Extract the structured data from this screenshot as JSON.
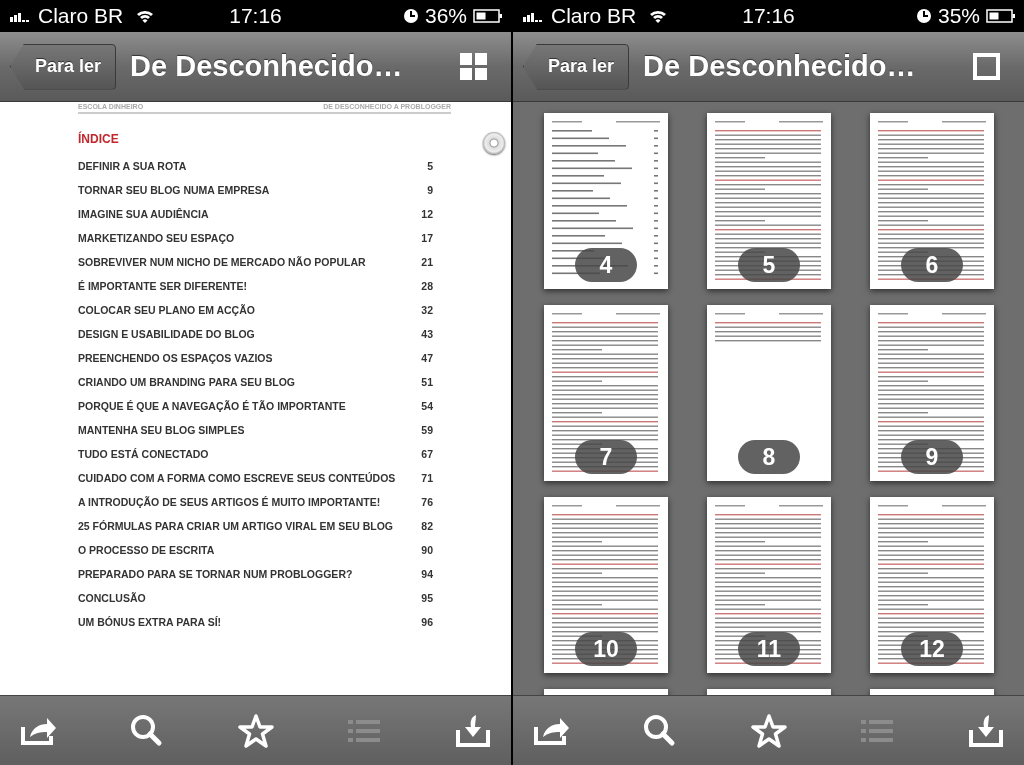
{
  "screens": [
    {
      "kind": "reader",
      "status_bar": {
        "carrier": "Claro BR",
        "time": "17:16",
        "battery": "36%"
      },
      "nav": {
        "back": "Para ler",
        "title": "De Desconhecido…",
        "view_button": {
          "kind": "grid"
        }
      },
      "page": {
        "header_left": "ESCOLA DINHEIRO",
        "header_right": "DE DESCONHECIDO A PROBLOGGER",
        "heading": "ÍNDICE",
        "entries": [
          {
            "title": "DEFINIR A SUA ROTA",
            "page": "5"
          },
          {
            "title": "TORNAR SEU BLOG NUMA EMPRESA",
            "page": "9"
          },
          {
            "title": "IMAGINE SUA AUDIÊNCIA",
            "page": "12"
          },
          {
            "title": "MARKETIZANDO SEU ESPAÇO",
            "page": "17"
          },
          {
            "title": "SOBREVIVER NUM NICHO DE MERCADO NÃO POPULAR",
            "page": "21"
          },
          {
            "title": "É IMPORTANTE SER DIFERENTE!",
            "page": "28"
          },
          {
            "title": "COLOCAR SEU PLANO EM ACÇÃO",
            "page": "32"
          },
          {
            "title": "DESIGN E USABILIDADE DO BLOG",
            "page": "43"
          },
          {
            "title": "PREENCHENDO OS ESPAÇOS VAZIOS",
            "page": "47"
          },
          {
            "title": "CRIANDO UM BRANDING PARA SEU BLOG",
            "page": "51"
          },
          {
            "title": "PORQUE É QUE A NAVEGAÇÃO É TÃO IMPORTANTE",
            "page": "54"
          },
          {
            "title": "MANTENHA SEU BLOG SIMPLES",
            "page": "59"
          },
          {
            "title": "TUDO ESTÁ CONECTADO",
            "page": "67"
          },
          {
            "title": "CUIDADO COM A FORMA COMO ESCREVE SEUS CONTEÚDOS",
            "page": "71"
          },
          {
            "title": "A INTRODUÇÃO DE SEUS ARTIGOS É MUITO IMPORTANTE!",
            "page": "76"
          },
          {
            "title": "25 FÓRMULAS PARA CRIAR UM ARTIGO VIRAL EM SEU BLOG",
            "page": "82"
          },
          {
            "title": "O PROCESSO DE ESCRITA",
            "page": "90"
          },
          {
            "title": "PREPARADO PARA SE TORNAR NUM PROBLOGGER?",
            "page": "94"
          },
          {
            "title": "CONCLUSÃO",
            "page": "95"
          },
          {
            "title": "UM BÓNUS EXTRA PARA SÍ!",
            "page": "96"
          }
        ]
      },
      "toolbar": [
        {
          "kind": "share",
          "disabled": false
        },
        {
          "kind": "search",
          "disabled": false
        },
        {
          "kind": "star",
          "disabled": false
        },
        {
          "kind": "list",
          "disabled": true
        },
        {
          "kind": "download",
          "disabled": false
        }
      ]
    },
    {
      "kind": "grid",
      "status_bar": {
        "carrier": "Claro BR",
        "time": "17:16",
        "battery": "35%"
      },
      "nav": {
        "back": "Para ler",
        "title": "De Desconhecido…",
        "view_button": {
          "kind": "single"
        }
      },
      "thumbnails": [
        {
          "label": "4",
          "kind": "toc"
        },
        {
          "label": "5",
          "kind": "text"
        },
        {
          "label": "6",
          "kind": "text"
        },
        {
          "label": "7",
          "kind": "text"
        },
        {
          "label": "8",
          "kind": "short"
        },
        {
          "label": "9",
          "kind": "text"
        },
        {
          "label": "10",
          "kind": "text"
        },
        {
          "label": "11",
          "kind": "text"
        },
        {
          "label": "12",
          "kind": "text"
        },
        {
          "kind": "text"
        },
        {
          "kind": "text"
        },
        {
          "kind": "text"
        }
      ],
      "toolbar": [
        {
          "kind": "share",
          "disabled": false
        },
        {
          "kind": "search",
          "disabled": false
        },
        {
          "kind": "star",
          "disabled": false
        },
        {
          "kind": "list",
          "disabled": true
        },
        {
          "kind": "download",
          "disabled": false
        }
      ]
    }
  ]
}
